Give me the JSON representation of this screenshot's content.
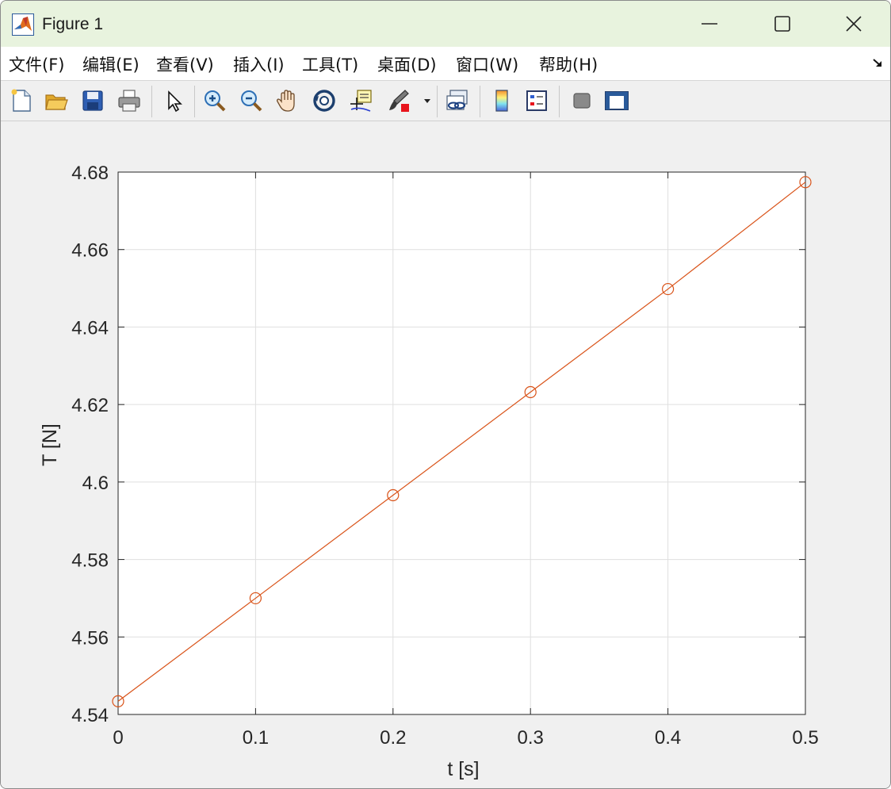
{
  "window": {
    "title": "Figure 1",
    "minimize_label": "",
    "maximize_label": "",
    "close_label": ""
  },
  "menu": {
    "items": [
      {
        "label": "文件(F)"
      },
      {
        "label": "编辑(E)"
      },
      {
        "label": "查看(V)"
      },
      {
        "label": "插入(I)"
      },
      {
        "label": "工具(T)"
      },
      {
        "label": "桌面(D)"
      },
      {
        "label": "窗口(W)"
      },
      {
        "label": "帮助(H)"
      }
    ]
  },
  "toolbar": {
    "icons": [
      "new-figure-icon",
      "open-file-icon",
      "save-icon",
      "print-icon",
      "select-arrow-icon",
      "zoom-in-icon",
      "zoom-out-icon",
      "pan-hand-icon",
      "rotate-3d-icon",
      "data-cursor-icon",
      "brush-icon",
      "brush-dropdown-icon",
      "link-plot-icon",
      "colorbar-icon",
      "legend-icon",
      "hide-plot-tools-icon",
      "show-plot-tools-icon"
    ]
  },
  "chart_data": {
    "type": "line",
    "title": "",
    "xlabel": "t [s]",
    "ylabel": "T [N]",
    "xlim": [
      0,
      0.5
    ],
    "ylim": [
      4.54,
      4.68
    ],
    "x_ticks": [
      "0",
      "0.1",
      "0.2",
      "0.3",
      "0.4",
      "0.5"
    ],
    "y_ticks": [
      "4.54",
      "4.56",
      "4.58",
      "4.6",
      "4.62",
      "4.64",
      "4.66",
      "4.68"
    ],
    "grid": true,
    "series": [
      {
        "color": "#d95319",
        "marker": "circle",
        "x": [
          0,
          0.1,
          0.2,
          0.3,
          0.4,
          0.5
        ],
        "y": [
          4.5434,
          4.57,
          4.5966,
          4.6232,
          4.6498,
          4.6774
        ]
      }
    ]
  }
}
